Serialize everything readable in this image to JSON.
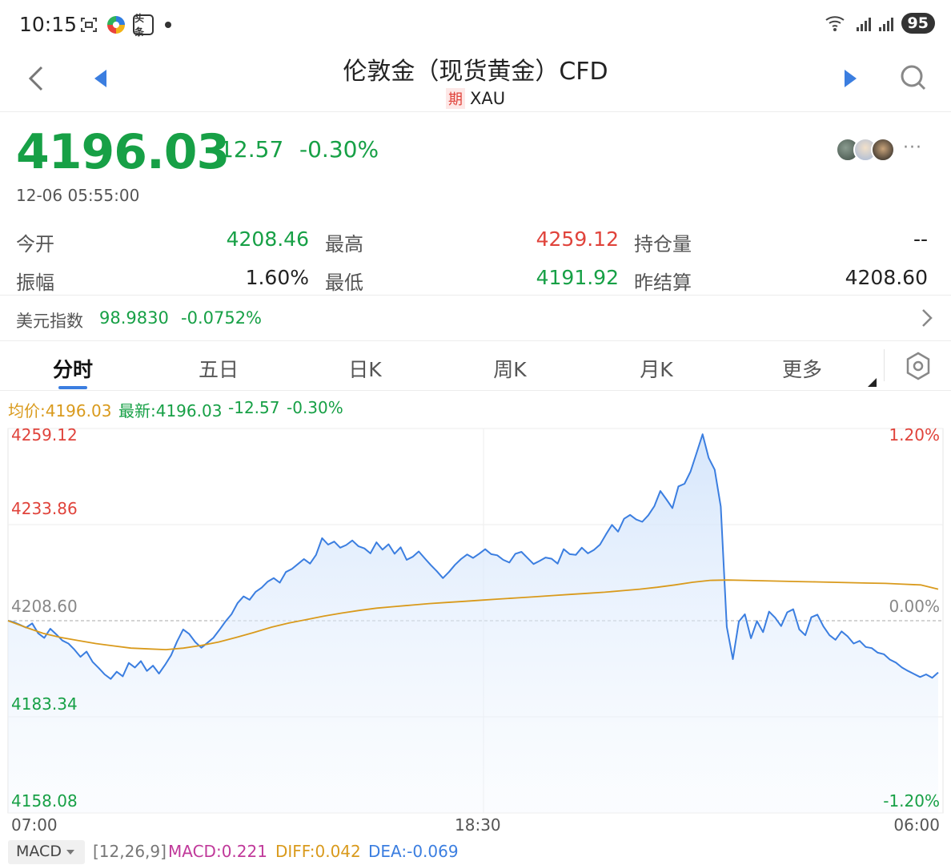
{
  "status_bar": {
    "time": "10:15",
    "battery": "95",
    "left_icons": [
      "screenshot-icon",
      "browser-icon",
      "toutiao-icon"
    ],
    "toutiao_label": "头条"
  },
  "header": {
    "title": "伦敦金（现货黄金）CFD",
    "badge": "期",
    "symbol": "XAU"
  },
  "quote": {
    "price": "4196.03",
    "change": "-12.57",
    "change_pct": "-0.30%",
    "timestamp": "12-06 05:55:00",
    "more": "···"
  },
  "stats": [
    {
      "label": "今开",
      "value": "4208.46",
      "color": "#17a046"
    },
    {
      "label": "最高",
      "value": "4259.12",
      "color": "#e0433b"
    },
    {
      "label": "持仓量",
      "value": "--",
      "color": "#222222"
    },
    {
      "label": "振幅",
      "value": "1.60%",
      "color": "#222222"
    },
    {
      "label": "最低",
      "value": "4191.92",
      "color": "#17a046"
    },
    {
      "label": "昨结算",
      "value": "4208.60",
      "color": "#222222"
    }
  ],
  "usd_index": {
    "label": "美元指数",
    "value": "98.9830",
    "change_pct": "-0.0752%"
  },
  "tabs": [
    {
      "label": "分时",
      "active": true
    },
    {
      "label": "五日",
      "active": false
    },
    {
      "label": "日K",
      "active": false
    },
    {
      "label": "周K",
      "active": false
    },
    {
      "label": "月K",
      "active": false
    },
    {
      "label": "更多",
      "active": false
    }
  ],
  "legend": {
    "avg": "均价:4196.03",
    "latest": "最新:4196.03",
    "change": "-12.57",
    "change_pct": "-0.30%"
  },
  "chart_data": {
    "type": "line",
    "title": "",
    "xlabel": "",
    "ylabel": "",
    "x_ticks": [
      "07:00",
      "18:30",
      "06:00"
    ],
    "y_ticks_left": [
      "4259.12",
      "4233.86",
      "4208.60",
      "4183.34",
      "4158.08"
    ],
    "y_ticks_right": [
      "1.20%",
      "0.00%",
      "-1.20%"
    ],
    "ylim": [
      4158.08,
      4259.12
    ],
    "reference_line": 4208.6,
    "series": [
      {
        "name": "最新",
        "color": "#3b7ee0",
        "values": [
          4208.6,
          4208.2,
          4207.5,
          4206.8,
          4207.9,
          4205.3,
          4204.1,
          4206.5,
          4205.0,
          4203.4,
          4202.6,
          4201.0,
          4199.1,
          4200.5,
          4197.8,
          4196.2,
          4194.5,
          4193.3,
          4195.2,
          4194.0,
          4197.5,
          4196.3,
          4198.0,
          4195.4,
          4196.8,
          4194.7,
          4197.0,
          4199.5,
          4203.2,
          4206.3,
          4205.1,
          4203.0,
          4201.5,
          4202.8,
          4204.1,
          4206.2,
          4208.4,
          4210.3,
          4213.2,
          4215.0,
          4214.1,
          4216.2,
          4217.3,
          4218.9,
          4219.8,
          4218.6,
          4221.4,
          4222.2,
          4223.5,
          4224.8,
          4223.6,
          4225.9,
          4230.3,
          4228.6,
          4229.4,
          4227.8,
          4228.5,
          4229.7,
          4228.2,
          4227.6,
          4226.3,
          4229.2,
          4227.3,
          4228.7,
          4226.2,
          4227.9,
          4224.6,
          4225.4,
          4226.8,
          4225.0,
          4223.2,
          4221.6,
          4219.8,
          4221.4,
          4223.3,
          4224.8,
          4226.0,
          4225.1,
          4226.2,
          4227.4,
          4226.1,
          4225.8,
          4224.6,
          4223.9,
          4226.2,
          4226.7,
          4225.1,
          4223.5,
          4224.3,
          4225.2,
          4224.9,
          4223.6,
          4227.4,
          4226.1,
          4225.9,
          4227.8,
          4226.3,
          4227.2,
          4228.6,
          4231.3,
          4233.8,
          4232.0,
          4235.4,
          4236.4,
          4235.2,
          4234.6,
          4236.3,
          4238.7,
          4242.7,
          4240.5,
          4238.2,
          4243.9,
          4244.6,
          4247.8,
          4252.7,
          4257.6,
          4251.4,
          4248.3,
          4238.6,
          4207.0,
          4198.5,
          4208.4,
          4210.3,
          4204.0,
          4208.5,
          4205.6,
          4211.0,
          4209.4,
          4207.2,
          4210.8,
          4211.6,
          4206.3,
          4204.8,
          4209.5,
          4210.2,
          4207.1,
          4204.8,
          4203.6,
          4205.8,
          4204.5,
          4202.6,
          4203.3,
          4201.7,
          4201.4,
          4200.2,
          4199.8,
          4198.4,
          4197.6,
          4196.3,
          4195.4,
          4194.6,
          4193.8,
          4194.5,
          4193.6,
          4195.0
        ]
      },
      {
        "name": "均价",
        "color": "#d99a1c",
        "values": [
          4208.6,
          4206.9,
          4205.3,
          4204.2,
          4203.4,
          4202.6,
          4202.0,
          4201.4,
          4201.2,
          4201.0,
          4201.4,
          4202.1,
          4203.0,
          4204.2,
          4205.5,
          4206.9,
          4208.0,
          4208.9,
          4209.8,
          4210.6,
          4211.3,
          4211.9,
          4212.3,
          4212.7,
          4213.1,
          4213.4,
          4213.7,
          4214.0,
          4214.3,
          4214.6,
          4214.9,
          4215.2,
          4215.5,
          4215.8,
          4216.1,
          4216.5,
          4216.9,
          4217.4,
          4218.0,
          4218.7,
          4219.2,
          4219.3,
          4219.2,
          4219.1,
          4219.0,
          4218.9,
          4218.8,
          4218.7,
          4218.6,
          4218.5,
          4218.4,
          4218.2,
          4218.0,
          4216.9
        ]
      }
    ]
  },
  "macd": {
    "selector": "MACD",
    "params": "[12,26,9]",
    "macd": "MACD:0.221",
    "diff": "DIFF:0.042",
    "dea": "DEA:-0.069"
  }
}
